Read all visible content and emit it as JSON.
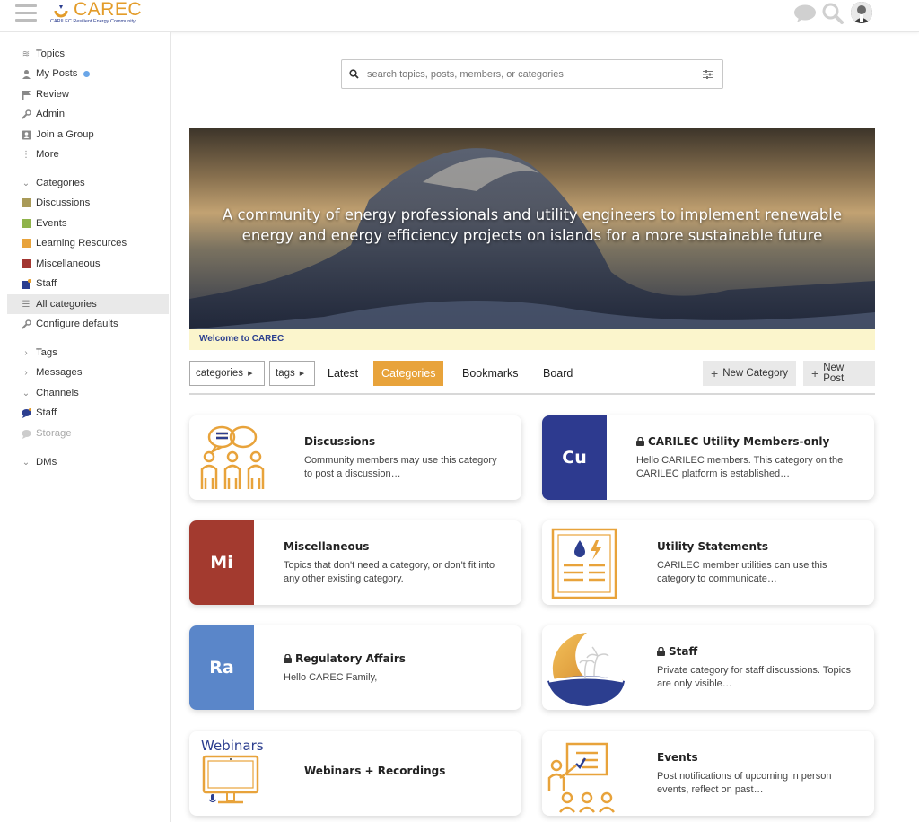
{
  "header": {
    "logo_text": "CAREC",
    "logo_subtitle": "CARILEC Resilient Energy Community",
    "icons": [
      "menu-icon",
      "chat-icon",
      "search-icon",
      "user-avatar"
    ]
  },
  "sidebar": {
    "top_items": [
      {
        "label": "Topics",
        "icon": "layers-icon"
      },
      {
        "label": "My Posts",
        "icon": "user-icon"
      },
      {
        "label": "Review",
        "icon": "flag-icon"
      },
      {
        "label": "Admin",
        "icon": "wrench-icon"
      },
      {
        "label": "Join a Group",
        "icon": "user-plus-icon"
      },
      {
        "label": "More",
        "icon": "more-icon"
      }
    ],
    "categories_header": "Categories",
    "categories": [
      {
        "label": "Discussions",
        "color": "#a99a58"
      },
      {
        "label": "Events",
        "color": "#8fb34a"
      },
      {
        "label": "Learning Resources",
        "color": "#e8a33b"
      },
      {
        "label": "Miscellaneous",
        "color": "#a23530"
      },
      {
        "label": "Staff",
        "color": "#2c3e8f"
      },
      {
        "label": "All categories",
        "icon": "list-icon"
      },
      {
        "label": "Configure defaults",
        "icon": "wrench-icon"
      }
    ],
    "sections": [
      {
        "label": "Tags"
      },
      {
        "label": "Messages"
      },
      {
        "label": "Channels"
      }
    ],
    "channels": [
      {
        "label": "Staff"
      },
      {
        "label": "Storage"
      }
    ],
    "dms": "DMs"
  },
  "search": {
    "placeholder": "search topics, posts, members, or categories"
  },
  "banner": {
    "text": "A community of energy professionals and utility engineers to implement renewable energy and energy efficiency projects on islands for a more sustainable future",
    "welcome": "Welcome to CAREC"
  },
  "nav": {
    "categories_dd": "categories",
    "tags_dd": "tags",
    "links": [
      "Latest",
      "Categories",
      "Bookmarks",
      "Board"
    ],
    "active": "Categories",
    "new_category": "New Category",
    "new_post": "New Post"
  },
  "cards": [
    {
      "title": "Discussions",
      "desc": "Community members may use this category to post a discussion…",
      "locked": false
    },
    {
      "title": "CARILEC Utility Members-only",
      "desc": "Hello CARILEC members. This category on the CARILEC platform is established…",
      "badge": "Cu",
      "badge_color": "#2d3a8f",
      "locked": true
    },
    {
      "title": "Miscellaneous",
      "desc": "Topics that don't need a category, or don't fit into any other existing category.",
      "badge": "Mi",
      "badge_color": "#a33a2f",
      "locked": false
    },
    {
      "title": "Utility Statements",
      "desc": "CARILEC member utilities can use this category to communicate…",
      "locked": false
    },
    {
      "title": "Regulatory Affairs",
      "desc": "Hello CAREC Family,",
      "badge": "Ra",
      "badge_color": "#5a86c9",
      "locked": true
    },
    {
      "title": "Staff",
      "desc": "Private category for staff discussions. Topics are only visible…",
      "locked": true
    },
    {
      "title": "Webinars + Recordings",
      "desc": "",
      "thumb_text": "Webinars",
      "locked": false
    },
    {
      "title": "Events",
      "desc": "Post notifications of upcoming in person events, reflect on past…",
      "locked": false
    }
  ]
}
